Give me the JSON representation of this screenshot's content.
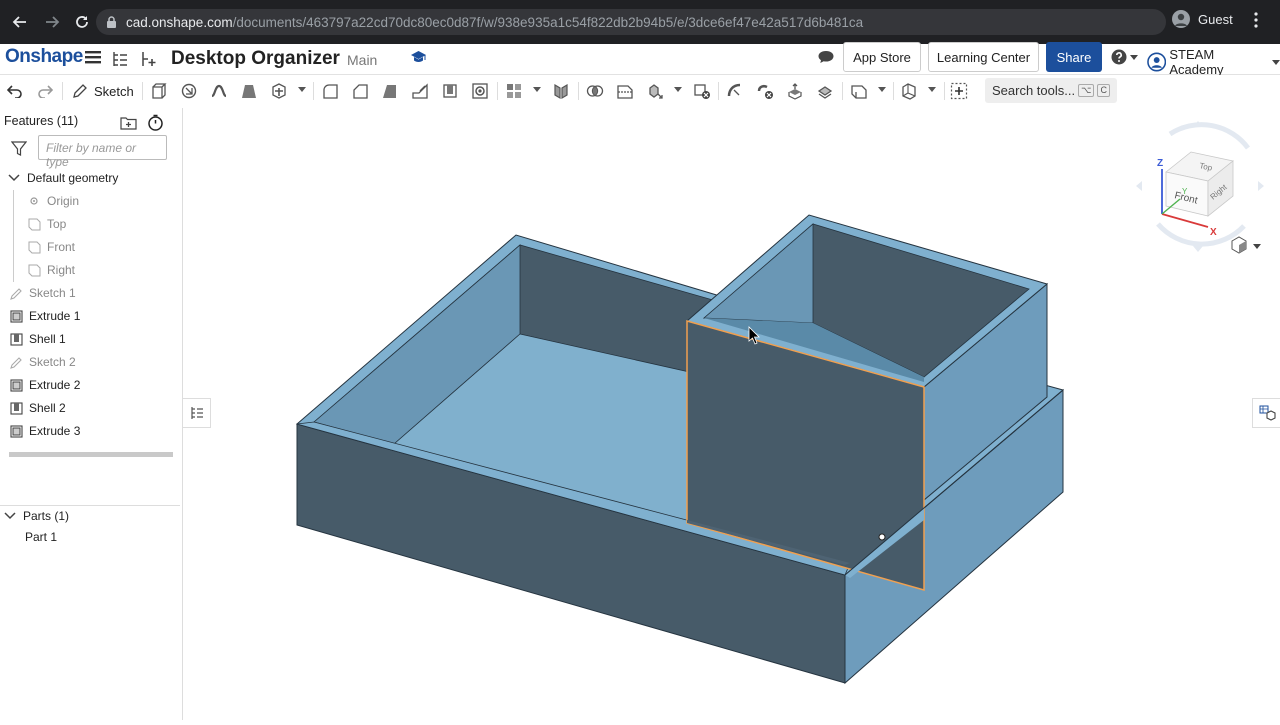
{
  "browser": {
    "url_host": "cad.onshape.com",
    "url_path": "/documents/463797a22cd70dc80ec0d87f/w/938e935a1c54f822db2b94b5/e/3dce6ef47e42a517d6b481ca",
    "profile": "Guest"
  },
  "header": {
    "logo": "Onshape",
    "doc_title": "Desktop Organizer",
    "branch": "Main",
    "app_store": "App Store",
    "learning_center": "Learning Center",
    "share": "Share",
    "account": "STEAM Academy"
  },
  "toolbar": {
    "sketch_label": "Sketch",
    "search_label": "Search tools...",
    "search_kbd_1": "⌥",
    "search_kbd_2": "C"
  },
  "features": {
    "title": "Features (11)",
    "filter_placeholder": "Filter by name or type",
    "default_geometry": "Default geometry",
    "items": [
      {
        "label": "Origin"
      },
      {
        "label": "Top"
      },
      {
        "label": "Front"
      },
      {
        "label": "Right"
      },
      {
        "label": "Sketch 1"
      },
      {
        "label": "Extrude 1"
      },
      {
        "label": "Shell 1"
      },
      {
        "label": "Sketch 2"
      },
      {
        "label": "Extrude 2"
      },
      {
        "label": "Shell 2"
      },
      {
        "label": "Extrude 3"
      }
    ]
  },
  "parts": {
    "title": "Parts (1)",
    "items": [
      {
        "label": "Part 1"
      }
    ]
  },
  "viewcube": {
    "top": "Top",
    "front": "Front",
    "right": "Right",
    "z": "Z",
    "x": "X",
    "y": "Y"
  },
  "colors": {
    "brand": "#1c4f9c",
    "model_light": "#7fb0cf",
    "model_mid": "#6b9bbb",
    "model_dark": "#475b69",
    "selection": "#f0a050"
  }
}
